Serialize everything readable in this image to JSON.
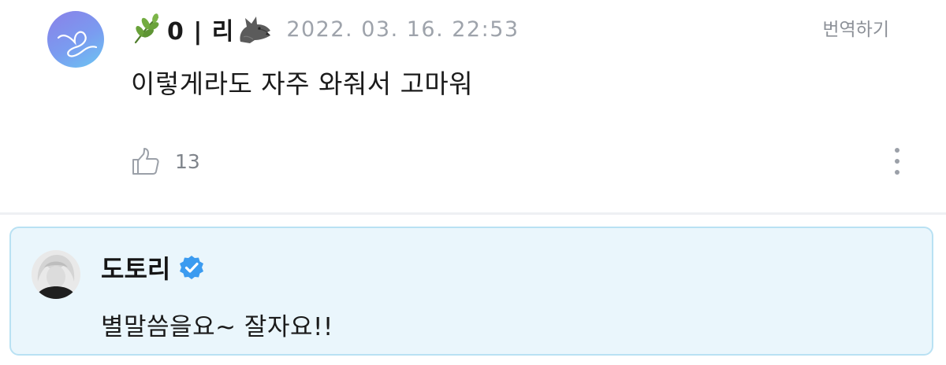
{
  "comment": {
    "username": "0 | 리",
    "leading_icon": "herb-icon",
    "trailing_icon": "wolf-icon",
    "timestamp": "2022. 03. 16. 22:53",
    "translate_label": "번역하기",
    "text": "이렇게라도 자주 와줘서 고마워",
    "like_count": "13"
  },
  "reply": {
    "username": "도토리",
    "verified": true,
    "text": "별말씀을요~ 잘자요!!"
  },
  "colors": {
    "reply_background": "#eaf6fc",
    "reply_border": "#b9e1f3",
    "verified_badge": "#3b9bf0",
    "secondary_text": "#9ea3ab"
  }
}
